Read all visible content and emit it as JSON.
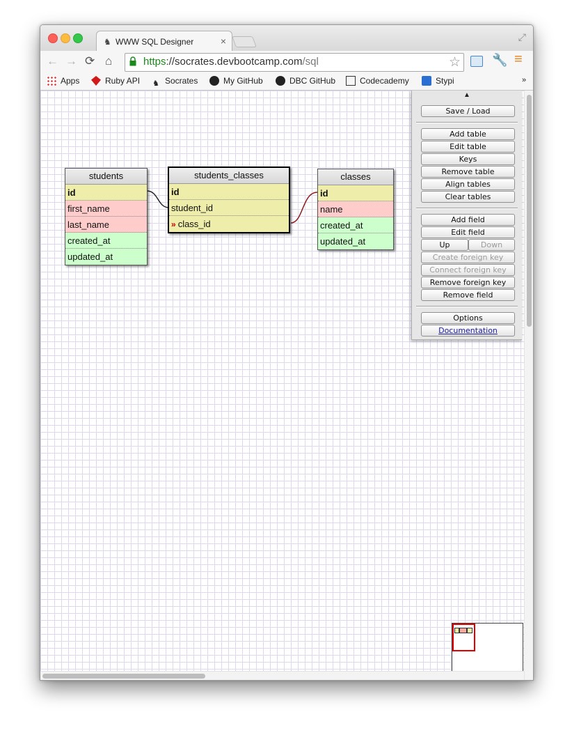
{
  "browser": {
    "tab_title": "WWW SQL Designer",
    "url_scheme": "https",
    "url_sep": "://",
    "url_host": "socrates.devbootcamp.com",
    "url_path": "/sql"
  },
  "bookmarks": [
    {
      "label": "Apps",
      "icon": "apps-grid-icon"
    },
    {
      "label": "Ruby API",
      "icon": "ruby-icon"
    },
    {
      "label": "Socrates",
      "icon": "socrates-icon"
    },
    {
      "label": "My GitHub",
      "icon": "github-icon"
    },
    {
      "label": "DBC GitHub",
      "icon": "github-icon"
    },
    {
      "label": "Codecademy",
      "icon": "codecademy-icon"
    },
    {
      "label": "Stypi",
      "icon": "stypi-icon"
    }
  ],
  "tables": {
    "students": {
      "name": "students",
      "fields": [
        {
          "name": "id",
          "kind": "primary"
        },
        {
          "name": "first_name",
          "kind": "text"
        },
        {
          "name": "last_name",
          "kind": "text"
        },
        {
          "name": "created_at",
          "kind": "datetime"
        },
        {
          "name": "updated_at",
          "kind": "datetime"
        }
      ]
    },
    "students_classes": {
      "name": "students_classes",
      "fields": [
        {
          "name": "id",
          "kind": "primary"
        },
        {
          "name": "student_id",
          "kind": "integer"
        },
        {
          "name": "class_id",
          "kind": "integer"
        }
      ]
    },
    "classes": {
      "name": "classes",
      "fields": [
        {
          "name": "id",
          "kind": "primary"
        },
        {
          "name": "name",
          "kind": "text"
        },
        {
          "name": "created_at",
          "kind": "datetime"
        },
        {
          "name": "updated_at",
          "kind": "datetime"
        }
      ]
    }
  },
  "panel": {
    "toggle": "▲",
    "save_load": "Save / Load",
    "add_table": "Add table",
    "edit_table": "Edit table",
    "keys": "Keys",
    "remove_table": "Remove table",
    "align_tables": "Align tables",
    "clear_tables": "Clear tables",
    "add_field": "Add field",
    "edit_field": "Edit field",
    "up": "Up",
    "down": "Down",
    "create_foreign_key": "Create foreign key",
    "connect_foreign_key": "Connect foreign key",
    "remove_foreign_key": "Remove foreign key",
    "remove_field": "Remove field",
    "options": "Options",
    "documentation": "Documentation"
  },
  "colors": {
    "primary_key": "#eeeeaa",
    "text": "#ffcccc",
    "datetime": "#ccffcc",
    "relation_student": "#222222",
    "relation_class": "#8b1a1a"
  }
}
